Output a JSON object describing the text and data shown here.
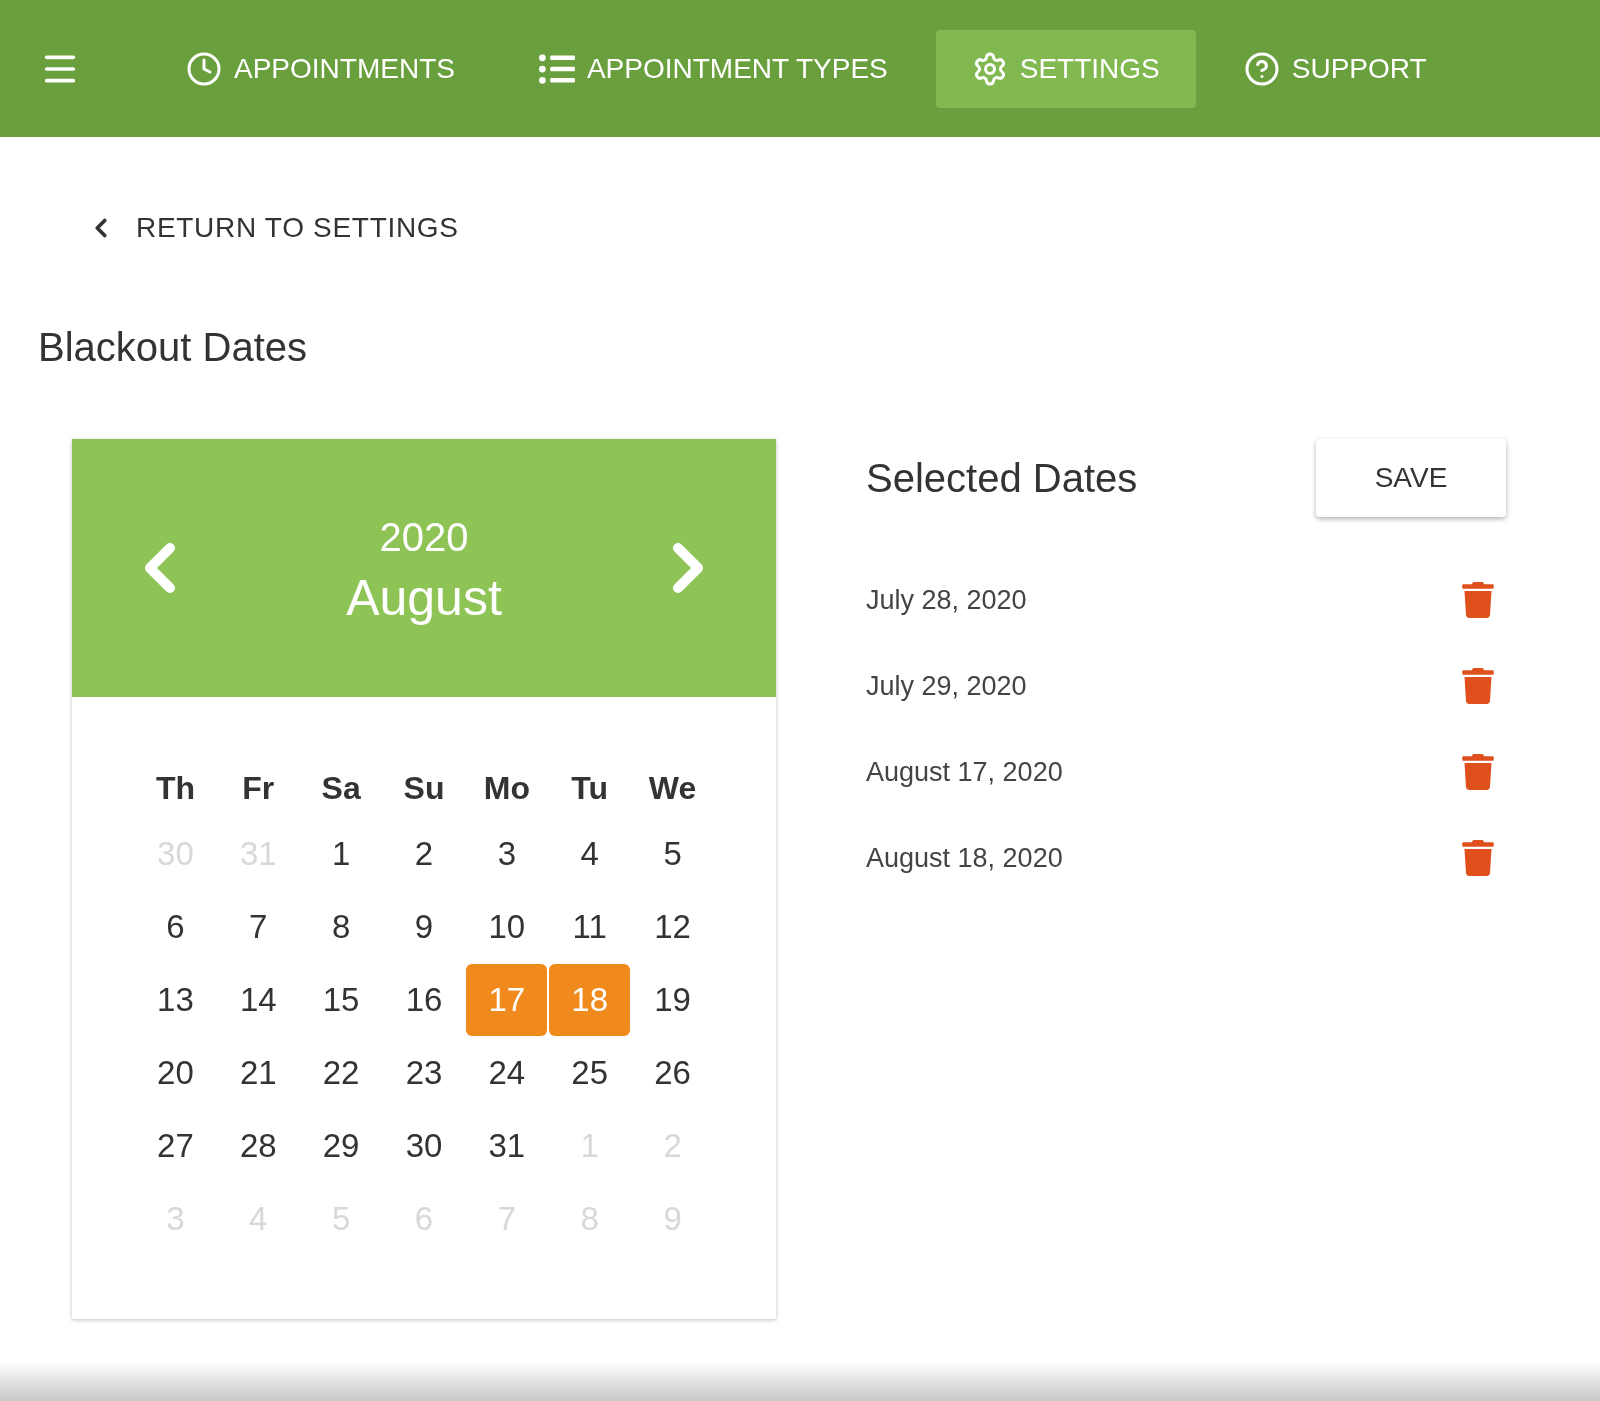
{
  "nav": {
    "tabs": [
      {
        "kind": "appointments",
        "label": "APPOINTMENTS",
        "selected": false
      },
      {
        "kind": "types",
        "label": "APPOINTMENT TYPES",
        "selected": false
      },
      {
        "kind": "settings",
        "label": "SETTINGS",
        "selected": true
      },
      {
        "kind": "support",
        "label": "SUPPORT",
        "selected": false
      }
    ]
  },
  "back_link": "RETURN TO SETTINGS",
  "page_title": "Blackout Dates",
  "calendar": {
    "year": "2020",
    "month": "August",
    "weekdays": [
      "Th",
      "Fr",
      "Sa",
      "Su",
      "Mo",
      "Tu",
      "We"
    ],
    "days": [
      {
        "label": "30",
        "muted": true,
        "selected": false
      },
      {
        "label": "31",
        "muted": true,
        "selected": false
      },
      {
        "label": "1",
        "muted": false,
        "selected": false
      },
      {
        "label": "2",
        "muted": false,
        "selected": false
      },
      {
        "label": "3",
        "muted": false,
        "selected": false
      },
      {
        "label": "4",
        "muted": false,
        "selected": false
      },
      {
        "label": "5",
        "muted": false,
        "selected": false
      },
      {
        "label": "6",
        "muted": false,
        "selected": false
      },
      {
        "label": "7",
        "muted": false,
        "selected": false
      },
      {
        "label": "8",
        "muted": false,
        "selected": false
      },
      {
        "label": "9",
        "muted": false,
        "selected": false
      },
      {
        "label": "10",
        "muted": false,
        "selected": false
      },
      {
        "label": "11",
        "muted": false,
        "selected": false
      },
      {
        "label": "12",
        "muted": false,
        "selected": false
      },
      {
        "label": "13",
        "muted": false,
        "selected": false
      },
      {
        "label": "14",
        "muted": false,
        "selected": false
      },
      {
        "label": "15",
        "muted": false,
        "selected": false
      },
      {
        "label": "16",
        "muted": false,
        "selected": false
      },
      {
        "label": "17",
        "muted": false,
        "selected": true
      },
      {
        "label": "18",
        "muted": false,
        "selected": true
      },
      {
        "label": "19",
        "muted": false,
        "selected": false
      },
      {
        "label": "20",
        "muted": false,
        "selected": false
      },
      {
        "label": "21",
        "muted": false,
        "selected": false
      },
      {
        "label": "22",
        "muted": false,
        "selected": false
      },
      {
        "label": "23",
        "muted": false,
        "selected": false
      },
      {
        "label": "24",
        "muted": false,
        "selected": false
      },
      {
        "label": "25",
        "muted": false,
        "selected": false
      },
      {
        "label": "26",
        "muted": false,
        "selected": false
      },
      {
        "label": "27",
        "muted": false,
        "selected": false
      },
      {
        "label": "28",
        "muted": false,
        "selected": false
      },
      {
        "label": "29",
        "muted": false,
        "selected": false
      },
      {
        "label": "30",
        "muted": false,
        "selected": false
      },
      {
        "label": "31",
        "muted": false,
        "selected": false
      },
      {
        "label": "1",
        "muted": true,
        "selected": false
      },
      {
        "label": "2",
        "muted": true,
        "selected": false
      },
      {
        "label": "3",
        "muted": true,
        "selected": false
      },
      {
        "label": "4",
        "muted": true,
        "selected": false
      },
      {
        "label": "5",
        "muted": true,
        "selected": false
      },
      {
        "label": "6",
        "muted": true,
        "selected": false
      },
      {
        "label": "7",
        "muted": true,
        "selected": false
      },
      {
        "label": "8",
        "muted": true,
        "selected": false
      },
      {
        "label": "9",
        "muted": true,
        "selected": false
      }
    ]
  },
  "selected_dates": {
    "title": "Selected Dates",
    "save_button": "SAVE",
    "items": [
      "July 28, 2020",
      "July 29, 2020",
      "August 17, 2020",
      "August 18, 2020"
    ]
  }
}
